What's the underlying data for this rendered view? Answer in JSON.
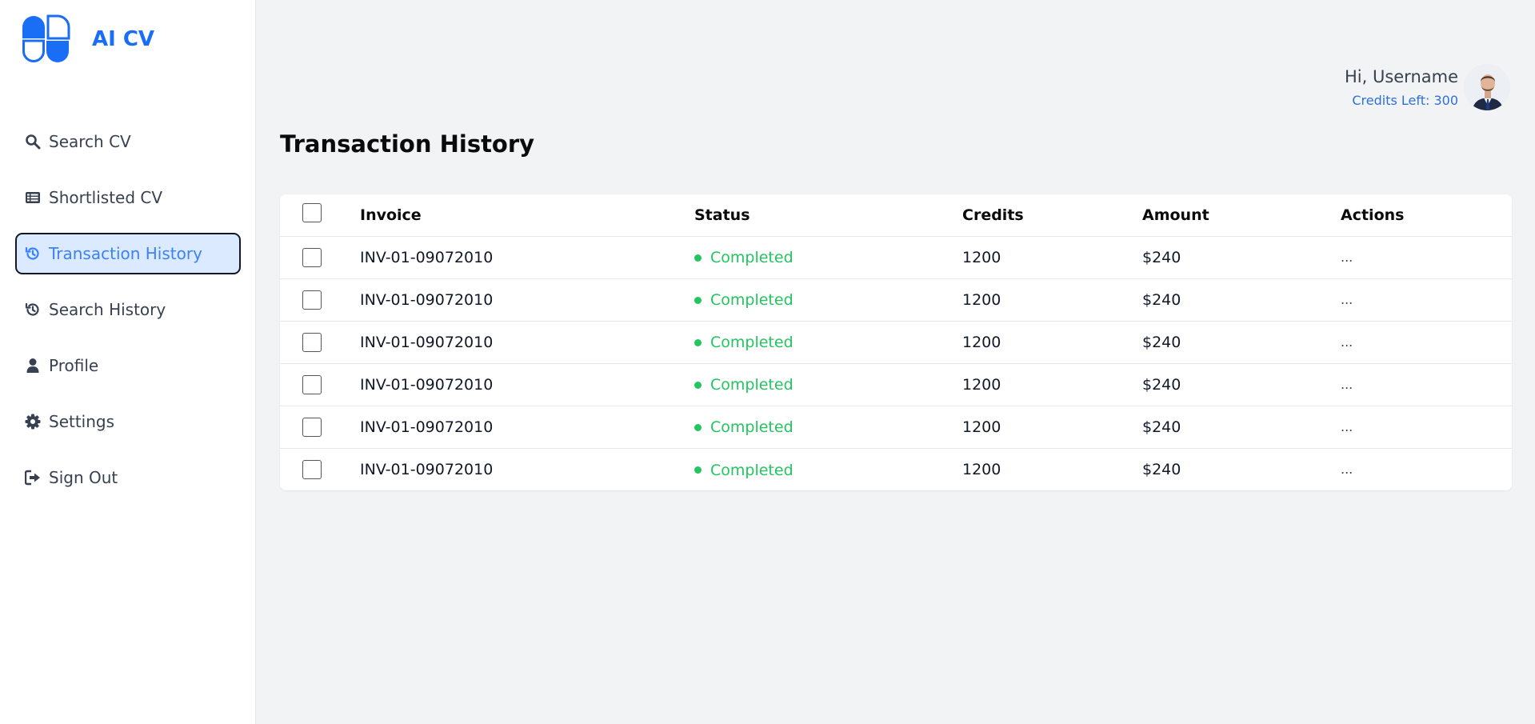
{
  "brand": {
    "name": "AI CV",
    "accent": "#1a6ef5"
  },
  "sidebar": {
    "items": [
      {
        "label": "Search CV",
        "icon": "search-icon"
      },
      {
        "label": "Shortlisted CV",
        "icon": "list-icon"
      },
      {
        "label": "Transaction History",
        "icon": "history-icon",
        "active": true
      },
      {
        "label": "Search History",
        "icon": "history-icon"
      },
      {
        "label": "Profile",
        "icon": "user-icon"
      },
      {
        "label": "Settings",
        "icon": "gear-icon"
      },
      {
        "label": "Sign Out",
        "icon": "sign-out-icon"
      }
    ]
  },
  "header": {
    "greeting": "Hi, Username",
    "credits_left": "Credits Left: 300"
  },
  "page": {
    "title": "Transaction History"
  },
  "table": {
    "columns": [
      "Invoice",
      "Status",
      "Credits",
      "Amount",
      "Actions"
    ],
    "rows": [
      {
        "invoice": "INV-01-09072010",
        "status": "Completed",
        "credits": "1200",
        "amount": "$240",
        "actions": "..."
      },
      {
        "invoice": "INV-01-09072010",
        "status": "Completed",
        "credits": "1200",
        "amount": "$240",
        "actions": "..."
      },
      {
        "invoice": "INV-01-09072010",
        "status": "Completed",
        "credits": "1200",
        "amount": "$240",
        "actions": "..."
      },
      {
        "invoice": "INV-01-09072010",
        "status": "Completed",
        "credits": "1200",
        "amount": "$240",
        "actions": "..."
      },
      {
        "invoice": "INV-01-09072010",
        "status": "Completed",
        "credits": "1200",
        "amount": "$240",
        "actions": "..."
      },
      {
        "invoice": "INV-01-09072010",
        "status": "Completed",
        "credits": "1200",
        "amount": "$240",
        "actions": "..."
      }
    ]
  },
  "colors": {
    "status_completed": "#22c55e",
    "active_nav_bg": "#dbeafe",
    "active_nav_text": "#3b82f6"
  }
}
